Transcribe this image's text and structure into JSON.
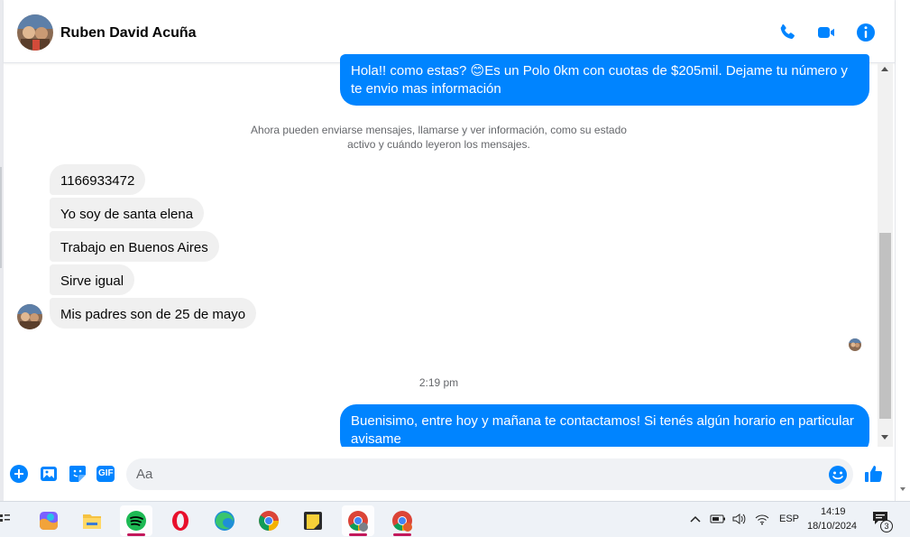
{
  "contact": {
    "name": "Ruben David Acuña"
  },
  "header": {
    "actions": [
      "phone-icon",
      "video-icon",
      "info-icon"
    ]
  },
  "messages": {
    "outgoing_1": "Hola!! como estas? 😊Es un Polo 0km con cuotas de $205mil. Dejame tu número y te envio mas información",
    "notice_line1": "Ahora pueden enviarse mensajes, llamarse y ver información, como su estado",
    "notice_line2": "activo y cuándo leyeron los mensajes.",
    "incoming": [
      "1166933472",
      "Yo soy de santa elena",
      "Trabajo en Buenos Aires",
      "Sirve igual",
      "Mis padres son de 25 de mayo"
    ],
    "time_separator": "2:19 pm",
    "outgoing_2": "Buenisimo, entre hoy y mañana te contactamos! Si tenés algún horario en particular avisame"
  },
  "composer": {
    "placeholder": "Aa",
    "icons": [
      "add-icon",
      "gallery-icon",
      "sticker-icon",
      "gif-icon",
      "emoji-icon",
      "like-icon"
    ],
    "gif_label": "GIF"
  },
  "taskbar": {
    "apps": [
      "copilot",
      "file-explorer",
      "spotify",
      "opera",
      "edge",
      "chrome",
      "sticky-notes",
      "chrome-profile",
      "chrome-profile-2"
    ],
    "language": "ESP",
    "time": "14:19",
    "date": "18/10/2024",
    "notification_count": "3"
  },
  "colors": {
    "accent": "#0084ff",
    "incoming_bg": "#f0f0f0",
    "text_secondary": "#65676b"
  }
}
